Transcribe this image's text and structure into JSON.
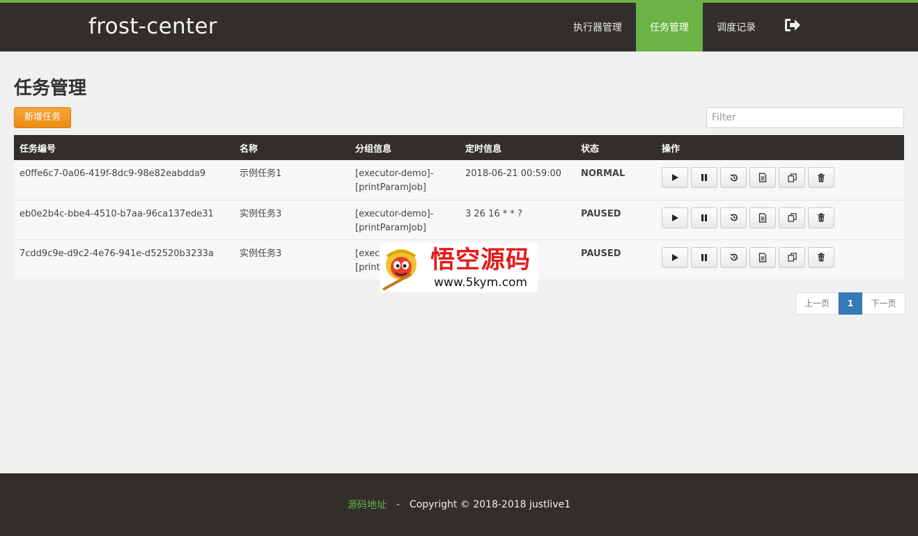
{
  "header": {
    "brand": "frost-center",
    "nav": [
      {
        "label": "执行器管理"
      },
      {
        "label": "任务管理"
      },
      {
        "label": "调度记录"
      }
    ],
    "logout_icon": "sign-out-icon"
  },
  "page": {
    "title": "任务管理",
    "add_button": "新增任务",
    "filter_placeholder": "Filter"
  },
  "table": {
    "columns": [
      "任务编号",
      "名称",
      "分组信息",
      "定时信息",
      "状态",
      "操作"
    ],
    "rows": [
      {
        "id": "e0ffe6c7-0a06-419f-8dc9-98e82eabdda9",
        "name": "示例任务1",
        "group": "[executor-demo]-[printParamJob]",
        "cron": "2018-06-21 00:59:00",
        "status": "NORMAL"
      },
      {
        "id": "eb0e2b4c-bbe4-4510-b7aa-96ca137ede31",
        "name": "实例任务3",
        "group": "[executor-demo]-[printParamJob]",
        "cron": "3 26 16 * * ?",
        "status": "PAUSED"
      },
      {
        "id": "7cdd9c9e-d9c2-4e76-941e-d52520b3233a",
        "name": "实例任务3",
        "group": "[executor-demo]-[printParamJob]",
        "cron": "",
        "status": "PAUSED"
      }
    ],
    "actions": [
      "play-icon",
      "pause-icon",
      "history-icon",
      "log-file-icon",
      "copy-icon",
      "trash-icon"
    ]
  },
  "pagination": {
    "prev": "上一页",
    "current": "1",
    "next": "下一页"
  },
  "watermark": {
    "cn": "悟空源码",
    "url": "www.5kym.com"
  },
  "footer": {
    "link": "源码地址",
    "sep": "-",
    "copyright": "Copyright © 2018-2018 justlive1"
  },
  "colors": {
    "accent": "#6ab344",
    "header_bg": "#312e2b",
    "normal": "#2ea300",
    "paused": "#ef8c0d",
    "add_button": "#f29a22",
    "page_active": "#337ab7"
  }
}
